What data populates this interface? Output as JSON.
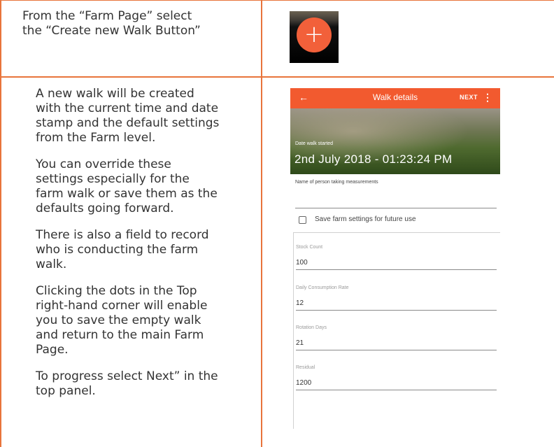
{
  "steps": [
    {
      "text_lines": [
        "From the “Farm Page” select",
        "the “Create new Walk Button”"
      ],
      "button": {
        "icon": "plus-icon",
        "glyph": "+",
        "color": "#f2603a"
      }
    },
    {
      "paragraphs": [
        [
          "A new walk will be created",
          "with the current time and date",
          "stamp and the default settings",
          "from the Farm level."
        ],
        [
          "You can override these",
          "settings especially for the",
          "farm walk or save them as the",
          "defaults going forward."
        ],
        [
          "There is also a field to record",
          "who is conducting the farm",
          "walk."
        ],
        [
          "Clicking the dots in the Top",
          "right-hand corner will enable",
          "you to save the empty walk",
          "and return to the main Farm",
          "Page."
        ],
        [
          "To progress select Next” in the",
          "top panel."
        ]
      ]
    }
  ],
  "phone": {
    "appbar": {
      "back": "←",
      "title": "Walk details",
      "next": "NEXT",
      "menu": "⋮",
      "color": "#f25a2f"
    },
    "banner": {
      "label": "Date walk started",
      "date": "2nd July  2018 - 01:23:24 PM"
    },
    "person_label": "Name of person taking measurements",
    "person_value": "",
    "save_checkbox": {
      "checked": false,
      "label": "Save farm settings for future use"
    },
    "fields": [
      {
        "label": "Stock Count",
        "value": "100"
      },
      {
        "label": "Daily Consumption Rate",
        "value": "12"
      },
      {
        "label": "Rotation Days",
        "value": "21"
      },
      {
        "label": "Residual",
        "value": "1200"
      }
    ]
  },
  "accent_color": "#e8743b"
}
